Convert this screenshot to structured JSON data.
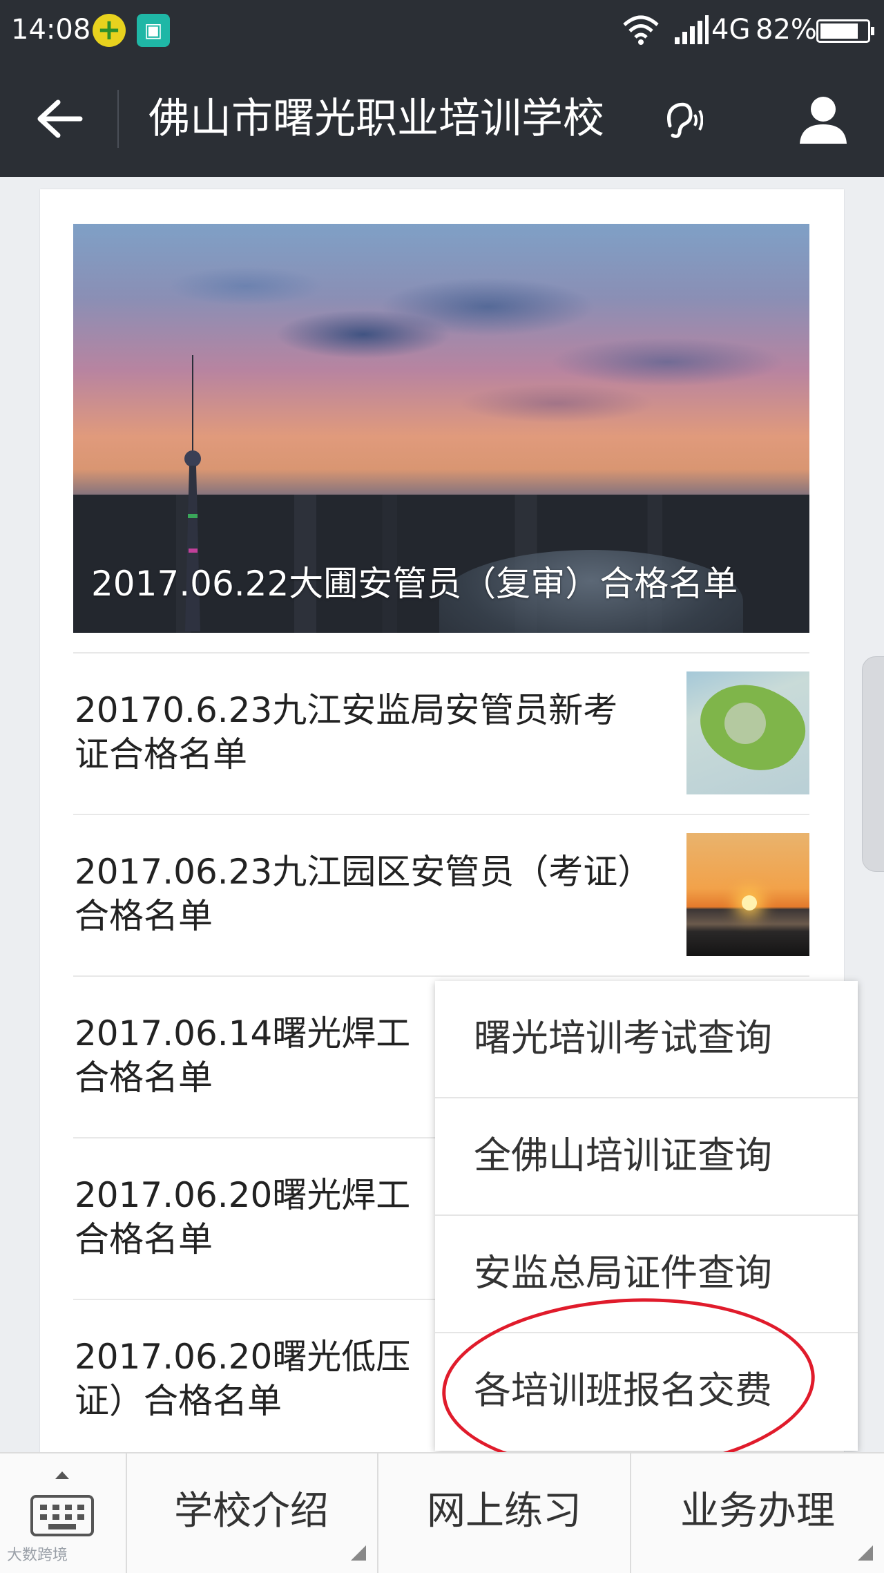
{
  "status_bar": {
    "time": "14:08",
    "network": "4G",
    "battery_pct": "82%",
    "battery_level": 0.82
  },
  "header": {
    "title": "佛山市曙光职业培训学校"
  },
  "featured": {
    "caption": "2017.06.22大圃安管员（复审）合格名单"
  },
  "articles": [
    {
      "title": "20170.6.23九江安监局安管员新考证合格名单",
      "thumbnail": "island-aerial"
    },
    {
      "title": "2017.06.23九江园区安管员（考证）合格名单",
      "thumbnail": "sunset"
    },
    {
      "title": "2017.06.14曙光焊工\n合格名单"
    },
    {
      "title": "2017.06.20曙光焊工\n合格名单"
    },
    {
      "title": "2017.06.20曙光低压\n证）合格名单"
    }
  ],
  "popup_menu": {
    "items": [
      "曙光培训考试查询",
      "全佛山培训证查询",
      "安监总局证件查询",
      "各培训班报名交费"
    ]
  },
  "bottom_menu": {
    "tabs": [
      "学校介绍",
      "网上练习",
      "业务办理"
    ]
  },
  "watermark": "大数跨境",
  "colors": {
    "header_bg": "#2b2f35",
    "annotation": "#e01b2b"
  }
}
